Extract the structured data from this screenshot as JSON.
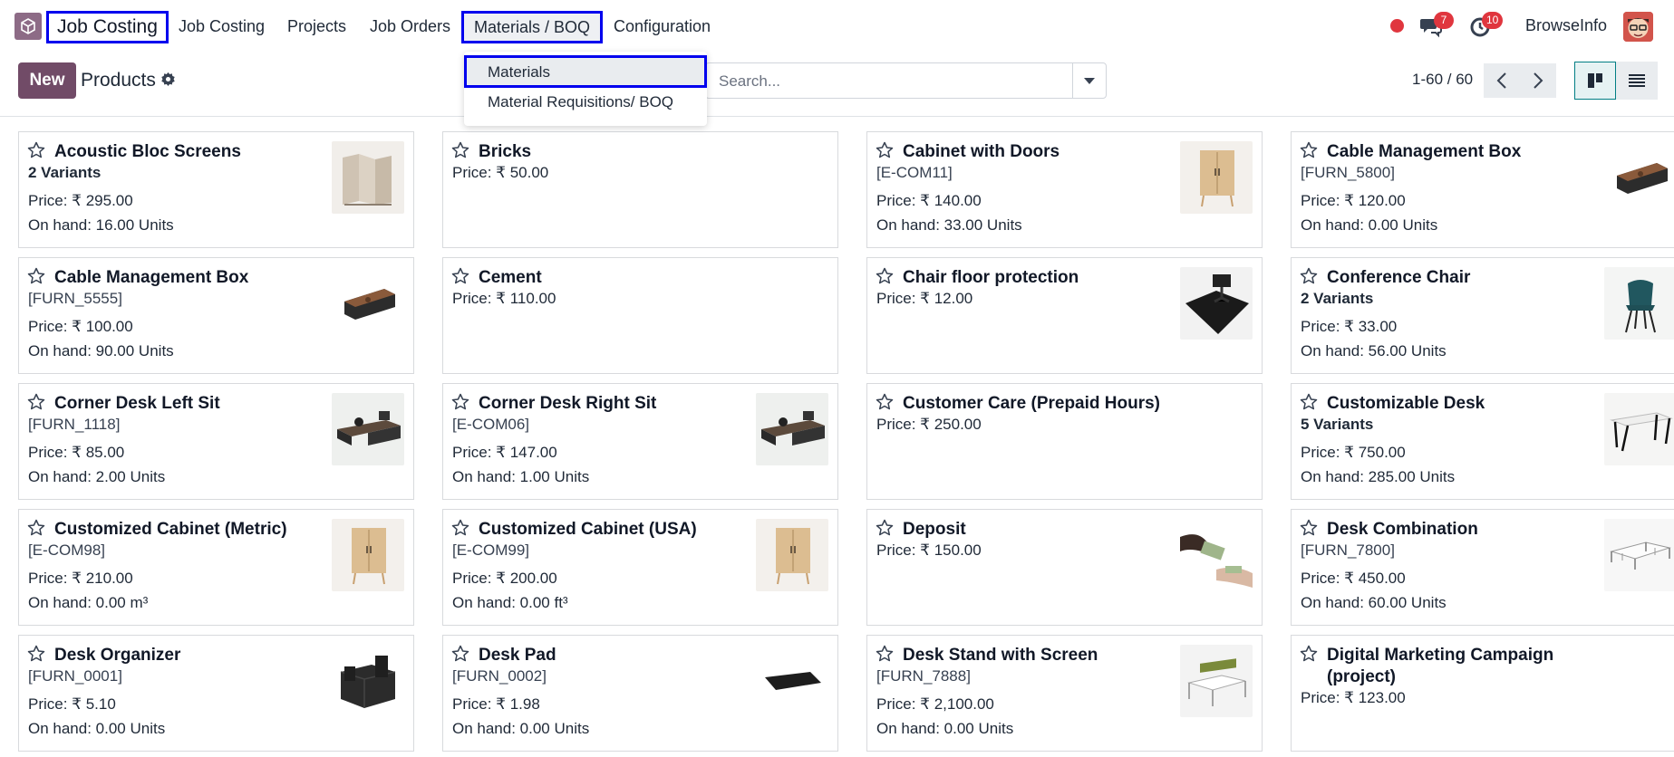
{
  "navbar": {
    "brand": "Job Costing",
    "menu": [
      "Job Costing",
      "Projects",
      "Job Orders",
      "Materials / BOQ",
      "Configuration"
    ],
    "messages_count": "7",
    "activities_count": "10",
    "user": "BrowseInfo"
  },
  "control": {
    "new_label": "New",
    "title": "Products",
    "search_placeholder": "Search...",
    "pager": "1-60 / 60"
  },
  "dropdown": {
    "items": [
      "Materials",
      "Material Requisitions/ BOQ"
    ]
  },
  "products": [
    {
      "name": "Acoustic Bloc Screens",
      "sub": "2 Variants",
      "variant": true,
      "price": "Price: ₹ 295.00",
      "onhand": "On hand: 16.00 Units",
      "img": "screens"
    },
    {
      "name": "Bricks",
      "sub": "",
      "variant": false,
      "price": "Price: ₹ 50.00",
      "onhand": "",
      "img": ""
    },
    {
      "name": "Cabinet with Doors",
      "sub": "[E-COM11]",
      "variant": false,
      "price": "Price: ₹ 140.00",
      "onhand": "On hand: 33.00 Units",
      "img": "cabinet"
    },
    {
      "name": "Cable Management Box",
      "sub": "[FURN_5800]",
      "variant": false,
      "price": "Price: ₹ 120.00",
      "onhand": "On hand: 0.00 Units",
      "img": "cablebox"
    },
    {
      "name": "Cable Management Box",
      "sub": "[FURN_5555]",
      "variant": false,
      "price": "Price: ₹ 100.00",
      "onhand": "On hand: 90.00 Units",
      "img": "cablebox"
    },
    {
      "name": "Cement",
      "sub": "",
      "variant": false,
      "price": "Price: ₹ 110.00",
      "onhand": "",
      "img": ""
    },
    {
      "name": "Chair floor protection",
      "sub": "",
      "variant": false,
      "price": "Price: ₹ 12.00",
      "onhand": "",
      "img": "floormat"
    },
    {
      "name": "Conference Chair",
      "sub": "2 Variants",
      "variant": true,
      "price": "Price: ₹ 33.00",
      "onhand": "On hand: 56.00 Units",
      "img": "chair"
    },
    {
      "name": "Corner Desk Left Sit",
      "sub": "[FURN_1118]",
      "variant": false,
      "price": "Price: ₹ 85.00",
      "onhand": "On hand: 2.00 Units",
      "img": "desk"
    },
    {
      "name": "Corner Desk Right Sit",
      "sub": "[E-COM06]",
      "variant": false,
      "price": "Price: ₹ 147.00",
      "onhand": "On hand: 1.00 Units",
      "img": "desk"
    },
    {
      "name": "Customer Care (Prepaid Hours)",
      "sub": "",
      "variant": false,
      "price": "Price: ₹ 250.00",
      "onhand": "",
      "img": ""
    },
    {
      "name": "Customizable Desk",
      "sub": "5 Variants",
      "variant": true,
      "price": "Price: ₹ 750.00",
      "onhand": "On hand: 285.00 Units",
      "img": "table"
    },
    {
      "name": "Customized Cabinet (Metric)",
      "sub": "[E-COM98]",
      "variant": false,
      "price": "Price: ₹ 210.00",
      "onhand": "On hand: 0.00 m³",
      "img": "cabinet"
    },
    {
      "name": "Customized Cabinet (USA)",
      "sub": "[E-COM99]",
      "variant": false,
      "price": "Price: ₹ 200.00",
      "onhand": "On hand: 0.00 ft³",
      "img": "cabinet"
    },
    {
      "name": "Deposit",
      "sub": "",
      "variant": false,
      "price": "Price: ₹ 150.00",
      "onhand": "",
      "img": "money"
    },
    {
      "name": "Desk Combination",
      "sub": "[FURN_7800]",
      "variant": false,
      "price": "Price: ₹ 450.00",
      "onhand": "On hand: 60.00 Units",
      "img": "deskcombo"
    },
    {
      "name": "Desk Organizer",
      "sub": "[FURN_0001]",
      "variant": false,
      "price": "Price: ₹ 5.10",
      "onhand": "On hand: 0.00 Units",
      "img": "organizer"
    },
    {
      "name": "Desk Pad",
      "sub": "[FURN_0002]",
      "variant": false,
      "price": "Price: ₹ 1.98",
      "onhand": "On hand: 0.00 Units",
      "img": "deskpad"
    },
    {
      "name": "Desk Stand with Screen",
      "sub": "[FURN_7888]",
      "variant": false,
      "price": "Price: ₹ 2,100.00",
      "onhand": "On hand: 0.00 Units",
      "img": "deskstand"
    },
    {
      "name": "Digital Marketing Campaign (project)",
      "sub": "",
      "variant": false,
      "price": "Price: ₹ 123.00",
      "onhand": "",
      "img": ""
    }
  ]
}
